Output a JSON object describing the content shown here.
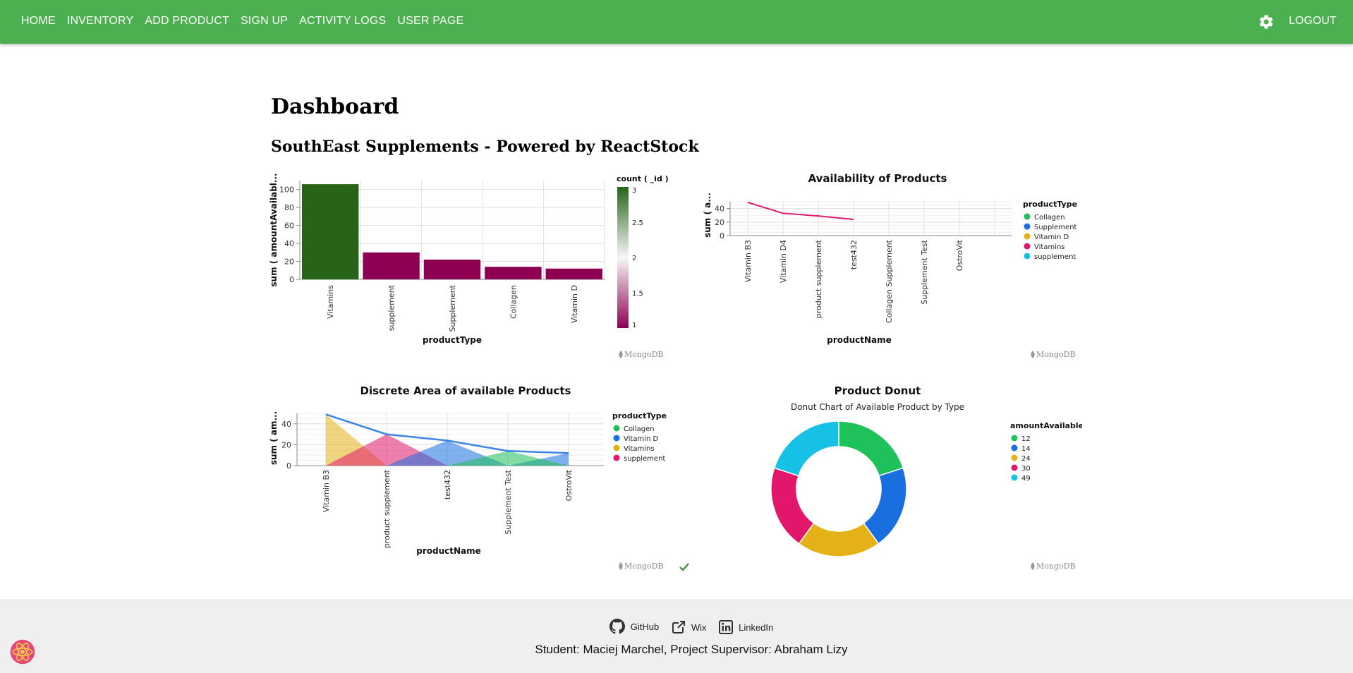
{
  "nav": {
    "items": [
      "HOME",
      "INVENTORY",
      "ADD PRODUCT",
      "SIGN UP",
      "ACTIVITY LOGS",
      "USER PAGE"
    ],
    "logout": "LOGOUT",
    "settings_icon": "gear-icon",
    "bar_color": "#4caf50"
  },
  "page": {
    "title": "Dashboard",
    "subtitle": "SouthEast Supplements - Powered by ReactStock"
  },
  "charts_brand": "MongoDB",
  "chart_data": [
    {
      "type": "bar",
      "title": "",
      "xlabel": "productType",
      "ylabel": "sum ( amountAvailabl...",
      "categories": [
        "Vitamins",
        "supplement",
        "Supplement",
        "Collagen",
        "Vitamin D"
      ],
      "values": [
        106,
        30,
        22,
        14,
        12
      ],
      "color_values": [
        3,
        1,
        1,
        1,
        1
      ],
      "ylim": [
        0,
        110
      ],
      "yticks": [
        "0",
        "20",
        "40",
        "60",
        "80",
        "100"
      ],
      "legend_title": "count ( _id )",
      "legend_ticks": [
        "3",
        "2.5",
        "2",
        "1.5",
        "1"
      ],
      "legend_colors": [
        "#276419",
        "#f7f7f7",
        "#8e0152"
      ]
    },
    {
      "type": "line",
      "title": "Availability of Products",
      "xlabel": "productName",
      "ylabel": "sum ( a...",
      "categories": [
        "Vitamin B3",
        "Vitamin D4",
        "product supplement",
        "test432",
        "Collagen Supplement",
        "Supplement Test",
        "OstroVit"
      ],
      "values": [
        49,
        33,
        29,
        24,
        null,
        null,
        null
      ],
      "ylim": [
        0,
        50
      ],
      "yticks": [
        "0",
        "20",
        "40"
      ],
      "legend_title": "productType",
      "legend": [
        {
          "label": "Collagen",
          "color": "#1ec15a"
        },
        {
          "label": "Supplement",
          "color": "#1a6fe0"
        },
        {
          "label": "Vitamin D",
          "color": "#e6b117"
        },
        {
          "label": "Vitamins",
          "color": "#e2176b"
        },
        {
          "label": "supplement",
          "color": "#17c1e6"
        }
      ]
    },
    {
      "type": "area",
      "title": "Discrete Area of available Products",
      "xlabel": "productName",
      "ylabel": "sum ( am...",
      "categories": [
        "Vitamin B3",
        "product supplement",
        "test432",
        "Supplement Test",
        "OstroVit"
      ],
      "series": [
        {
          "name": "Vitamins",
          "values": [
            49,
            0,
            0,
            0,
            0
          ]
        },
        {
          "name": "supplement",
          "values": [
            0,
            30,
            0,
            0,
            0
          ]
        },
        {
          "name": "Vitamin D",
          "values": [
            0,
            0,
            24,
            0,
            12
          ]
        },
        {
          "name": "Collagen",
          "values": [
            0,
            0,
            0,
            14,
            0
          ]
        }
      ],
      "ylim": [
        0,
        50
      ],
      "yticks": [
        "0",
        "20",
        "40"
      ],
      "legend_title": "productType",
      "legend": [
        {
          "label": "Collagen",
          "color": "#1ec15a"
        },
        {
          "label": "Vitamin D",
          "color": "#1a6fe0"
        },
        {
          "label": "Vitamins",
          "color": "#e6b117"
        },
        {
          "label": "supplement",
          "color": "#e2176b"
        }
      ]
    },
    {
      "type": "pie",
      "title": "Product Donut",
      "subtitle": "Donut Chart of Available Product by Type",
      "categories": [
        "12",
        "14",
        "24",
        "30",
        "49"
      ],
      "values": [
        49,
        49,
        49,
        49,
        49
      ],
      "legend_title": "amountAvailable",
      "legend": [
        {
          "label": "12",
          "color": "#1ec15a"
        },
        {
          "label": "14",
          "color": "#1a6fe0"
        },
        {
          "label": "24",
          "color": "#e6b117"
        },
        {
          "label": "30",
          "color": "#e2176b"
        },
        {
          "label": "49",
          "color": "#17c1e6"
        }
      ]
    }
  ],
  "footer": {
    "github": "GitHub",
    "wix": "Wix",
    "linkedin": "LinkedIn",
    "credits": "Student: Maciej Marchel, Project Supervisor: Abraham Lizy"
  }
}
